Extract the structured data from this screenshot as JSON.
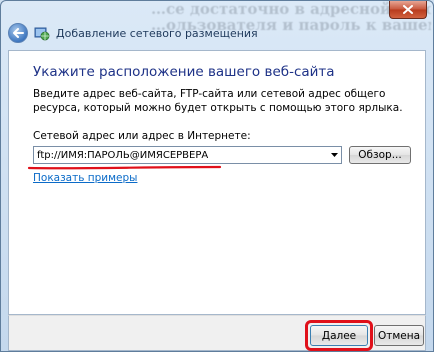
{
  "background_text": {
    "line1": "…се достаточно в адресной строке набрать вот такую строку",
    "line2": "…ользователя и пароль к вашему сайту ¶"
  },
  "window": {
    "title": "Добавление сетевого размещения",
    "back_icon": "back-arrow-icon",
    "title_icon": "globe-network-icon",
    "close_icon": "close-icon"
  },
  "content": {
    "heading": "Укажите расположение вашего веб-сайта",
    "description": "Введите адрес веб-сайта, FTP-сайта или сетевой адрес общего ресурса, который можно будет открыть с помощью этого ярлыка.",
    "address_label": "Сетевой адрес или адрес в Интернете:",
    "address_value": "ftp://ИМЯ:ПАРОЛЬ@ИМЯСЕРВЕРА",
    "browse_label": "Обзор...",
    "examples_link": "Показать примеры"
  },
  "footer": {
    "next_label": "Далее",
    "cancel_label": "Отмена"
  },
  "colors": {
    "heading": "#1e3287",
    "link": "#0b6bc8",
    "highlight": "#e0101a"
  }
}
